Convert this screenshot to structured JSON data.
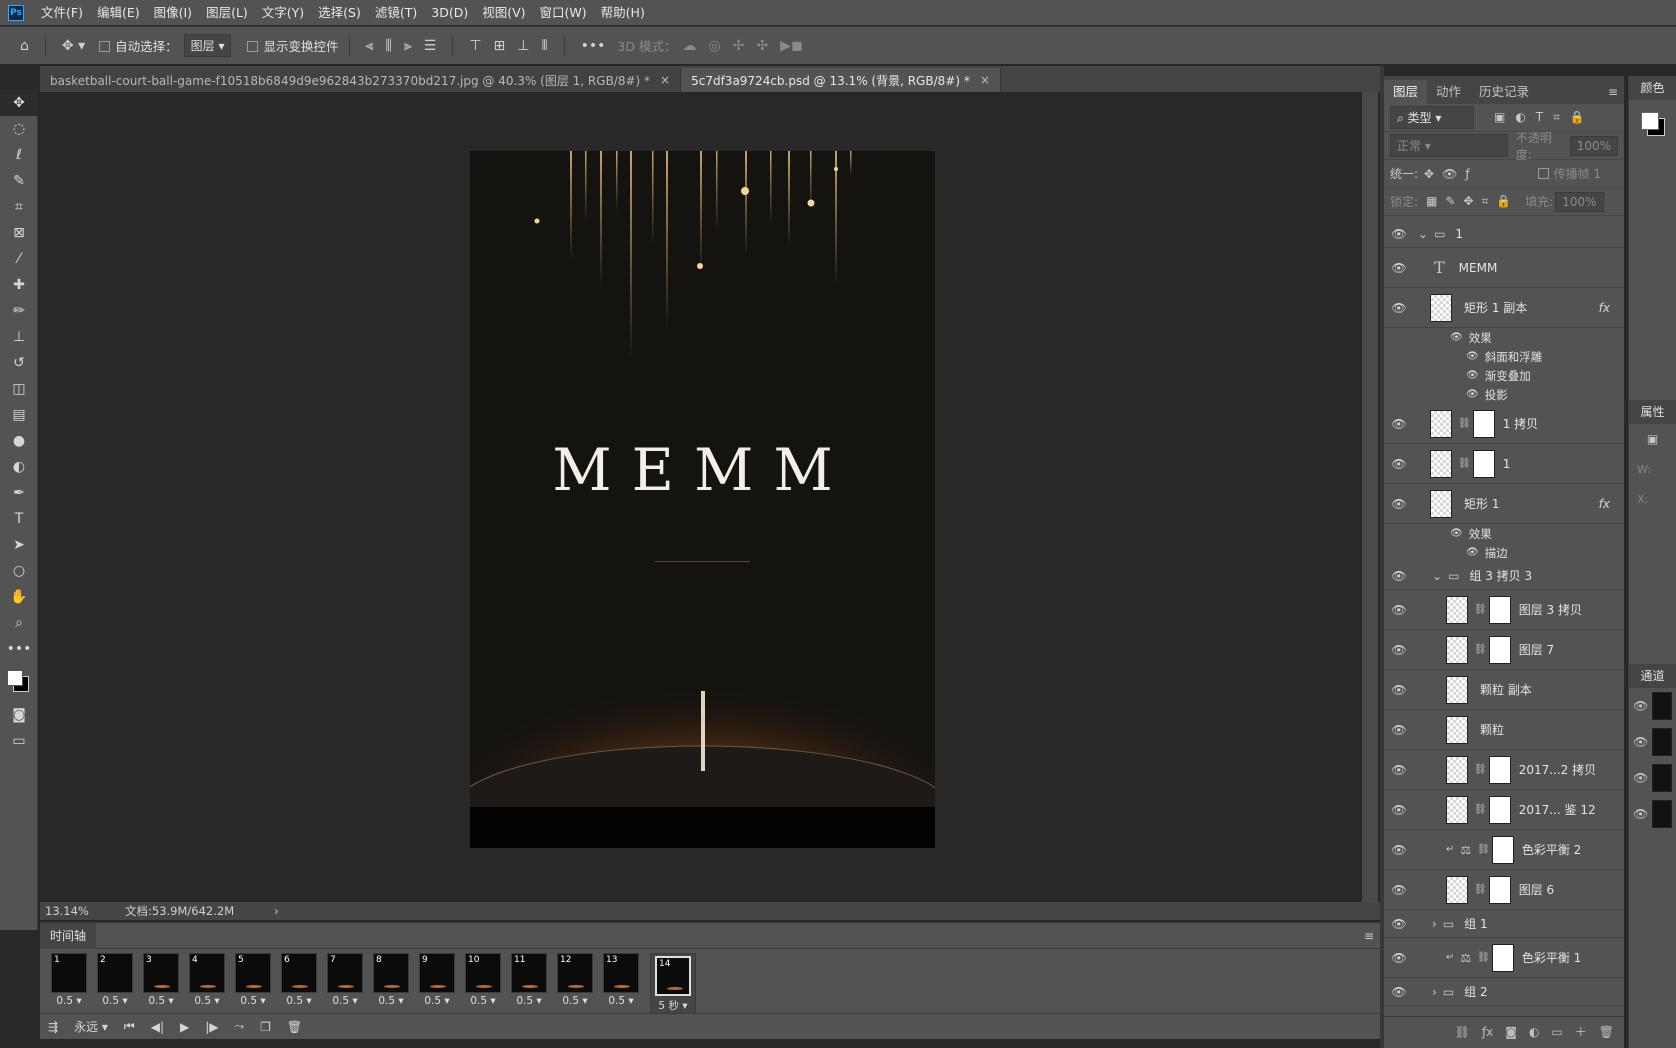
{
  "menubar": {
    "app_icon": "Ps",
    "items": [
      "文件(F)",
      "编辑(E)",
      "图像(I)",
      "图层(L)",
      "文字(Y)",
      "选择(S)",
      "滤镜(T)",
      "3D(D)",
      "视图(V)",
      "窗口(W)",
      "帮助(H)"
    ]
  },
  "options": {
    "auto_select_label": "自动选择：",
    "auto_select_value": "图层",
    "show_transform_label": "显示变换控件",
    "mode_3d_label": "3D 模式："
  },
  "tabs": [
    {
      "label": "basketball-court-ball-game-f10518b6849d9e962843b273370bd217.jpg @ 40.3% (图层 1, RGB/8#) *",
      "close": "×"
    },
    {
      "label": "5c7df3a9724cb.psd @ 13.1% (背景, RGB/8#) *",
      "close": "×"
    }
  ],
  "canvas": {
    "title_text": "MEMM"
  },
  "status": {
    "zoom": "13.14%",
    "doc_info": "文档:53.9M/642.2M",
    "arrow": "›"
  },
  "timeline": {
    "title": "时间轴",
    "frames": [
      {
        "num": "1",
        "dur": "0.5"
      },
      {
        "num": "2",
        "dur": "0.5"
      },
      {
        "num": "3",
        "dur": "0.5"
      },
      {
        "num": "4",
        "dur": "0.5"
      },
      {
        "num": "5",
        "dur": "0.5"
      },
      {
        "num": "6",
        "dur": "0.5"
      },
      {
        "num": "7",
        "dur": "0.5"
      },
      {
        "num": "8",
        "dur": "0.5"
      },
      {
        "num": "9",
        "dur": "0.5"
      },
      {
        "num": "10",
        "dur": "0.5"
      },
      {
        "num": "11",
        "dur": "0.5"
      },
      {
        "num": "12",
        "dur": "0.5"
      },
      {
        "num": "13",
        "dur": "0.5"
      },
      {
        "num": "14",
        "dur": "5 秒"
      }
    ],
    "loop": "永远"
  },
  "layers_panel": {
    "tabs": [
      "图层",
      "动作",
      "历史记录"
    ],
    "filter_kind": "类型",
    "blend_mode": "正常",
    "opacity_label": "不透明度:",
    "opacity_value": "100%",
    "unify_label": "统一:",
    "propagate_label": "传播帧 1",
    "lock_label": "锁定:",
    "fill_label": "填充:",
    "fill_value": "100%",
    "layers": [
      {
        "name": "1",
        "kind": "group-open"
      },
      {
        "name": "MEMM",
        "kind": "text"
      },
      {
        "name": "矩形 1 副本",
        "kind": "shape-fx"
      },
      {
        "name": "效果",
        "kind": "sub"
      },
      {
        "name": "斜面和浮雕",
        "kind": "sub2"
      },
      {
        "name": "渐变叠加",
        "kind": "sub2"
      },
      {
        "name": "投影",
        "kind": "sub2"
      },
      {
        "name": "1 拷贝",
        "kind": "masked"
      },
      {
        "name": "1",
        "kind": "masked"
      },
      {
        "name": "矩形 1",
        "kind": "shape-fx"
      },
      {
        "name": "效果",
        "kind": "sub"
      },
      {
        "name": "描边",
        "kind": "sub2"
      },
      {
        "name": "组 3 拷贝 3",
        "kind": "group-open"
      },
      {
        "name": "图层 3 拷贝",
        "kind": "masked"
      },
      {
        "name": "图层 7",
        "kind": "masked"
      },
      {
        "name": "颗粒 副本",
        "kind": "plain"
      },
      {
        "name": "颗粒",
        "kind": "plain"
      },
      {
        "name": "2017...2 拷贝",
        "kind": "masked"
      },
      {
        "name": "2017... 鉴 12",
        "kind": "masked"
      },
      {
        "name": "色彩平衡 2",
        "kind": "adjust"
      },
      {
        "name": "图层 6",
        "kind": "masked"
      },
      {
        "name": "组 1",
        "kind": "group-closed"
      },
      {
        "name": "色彩平衡 1",
        "kind": "adjust"
      },
      {
        "name": "组 2",
        "kind": "group-closed"
      }
    ]
  },
  "right_column": {
    "color_title": "颜色",
    "props_title": "属性",
    "channels_title": "通道",
    "w_label": "W:",
    "x_label": "X:"
  }
}
